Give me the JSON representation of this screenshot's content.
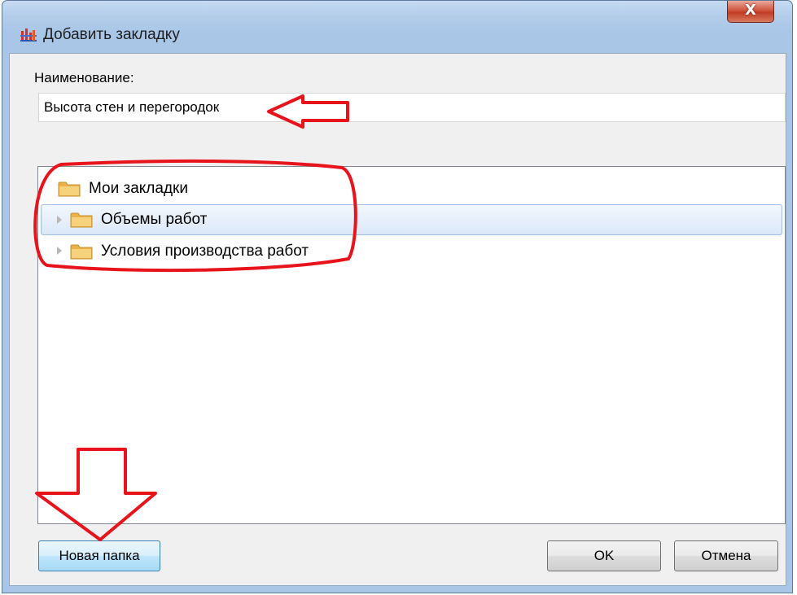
{
  "window": {
    "title": "Добавить закладку",
    "close_glyph": "X"
  },
  "form": {
    "name_label": "Наименование:",
    "name_value": "Высота стен и перегородок"
  },
  "tree": {
    "items": [
      {
        "label": "Мои закладки",
        "expandable": false,
        "selected": false,
        "icon": "folder-icon"
      },
      {
        "label": "Объемы работ",
        "expandable": true,
        "selected": true,
        "icon": "folder-icon"
      },
      {
        "label": "Условия производства работ",
        "expandable": true,
        "selected": false,
        "icon": "folder-icon"
      }
    ]
  },
  "buttons": {
    "new_folder": "Новая папка",
    "ok": "OK",
    "cancel": "Отмена"
  },
  "colors": {
    "annotation": "#e8141c",
    "selection": "#dbe8f8",
    "folder": "#f2c35b"
  }
}
